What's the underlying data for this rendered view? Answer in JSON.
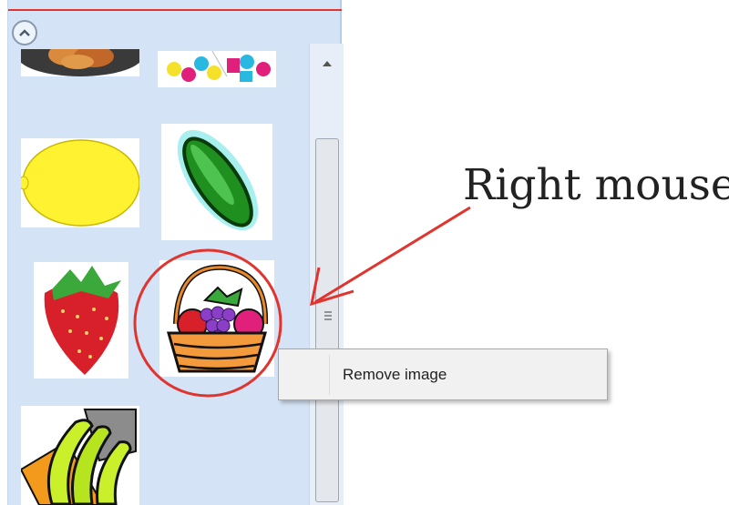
{
  "panel": {
    "images": [
      {
        "name": "food-plate-image"
      },
      {
        "name": "colorful-shapes-image"
      },
      {
        "name": "lemon-image"
      },
      {
        "name": "cucumber-image"
      },
      {
        "name": "strawberry-image"
      },
      {
        "name": "fruit-basket-image"
      },
      {
        "name": "bananas-image"
      }
    ]
  },
  "context_menu": {
    "items": [
      {
        "label": "Remove image"
      }
    ]
  },
  "annotation": {
    "text": "Right mouse",
    "color": "#e0342f"
  },
  "colors": {
    "panel_bg": "#d4e3f5",
    "accent": "#e0342f"
  }
}
